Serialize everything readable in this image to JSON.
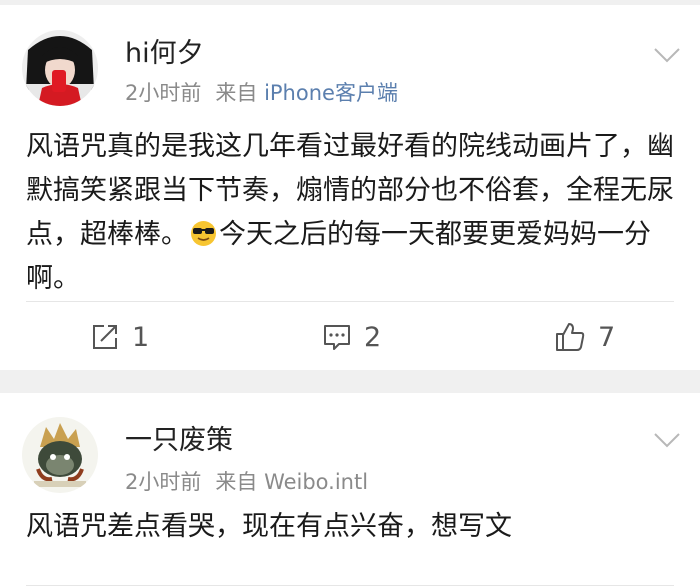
{
  "posts": [
    {
      "username": "hi何夕",
      "time": "2小时前",
      "source_prefix": "来自",
      "source": "iPhone客户端",
      "text_before_emoji": "风语咒真的是我这几年看过最好看的院线动画片了，幽默搞笑紧跟当下节奏，煽情的部分也不俗套，全程无尿点，超棒棒。",
      "emoji": "sunglasses-emoji",
      "text_after_emoji": "今天之后的每一天都要更爱妈妈一分啊。",
      "repost_count": "1",
      "comment_count": "2",
      "like_count": "7"
    },
    {
      "username": "一只废策",
      "time": "2小时前",
      "source_prefix": "来自",
      "source": "Weibo.intl",
      "text": "风语咒差点看哭，现在有点兴奋，想写文"
    }
  ],
  "colors": {
    "background": "#f0f0f0",
    "card": "#ffffff",
    "username": "#222222",
    "meta": "#8a8a8a",
    "source_link": "#5b7fae",
    "body_text": "#1a1a1a",
    "action": "#555555"
  },
  "icons": {
    "more": "chevron-down-icon",
    "repost": "repost-icon",
    "comment": "comment-icon",
    "like": "thumbs-up-icon"
  }
}
